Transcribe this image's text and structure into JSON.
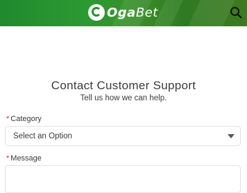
{
  "header": {
    "logo_primary": "Oga",
    "logo_secondary": "Bet",
    "search_icon": "search-icon",
    "brand_color": "#2c9a33"
  },
  "main": {
    "title": "Contact Customer Support",
    "subtitle": "Tell us how we can help.",
    "required_marker": "*",
    "category": {
      "label": "Category",
      "selected": "Select an Option"
    },
    "message": {
      "label": "Message",
      "value": ""
    }
  }
}
